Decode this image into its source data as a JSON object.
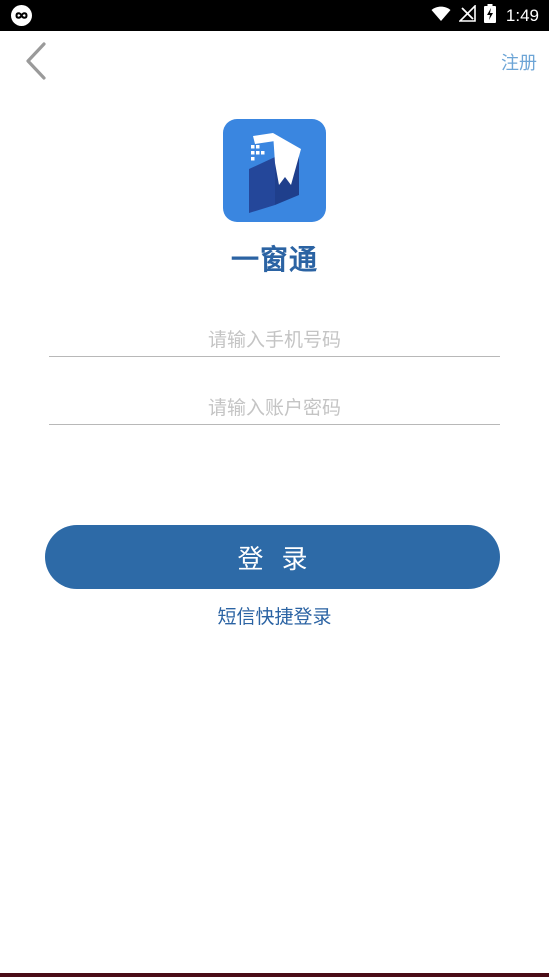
{
  "status_bar": {
    "time": "1:49"
  },
  "header": {
    "register_label": "注册"
  },
  "app": {
    "title": "一窗通",
    "brand_color": "#3a86e0",
    "accent_color": "#2d6aa7"
  },
  "form": {
    "phone_placeholder": "请输入手机号码",
    "password_placeholder": "请输入账户密码",
    "login_label": "登录",
    "sms_login_label": "短信快捷登录"
  },
  "icons": {
    "back": "back-arrow-icon",
    "wifi": "wifi-icon",
    "signal": "no-signal-icon",
    "battery": "battery-charging-icon"
  }
}
